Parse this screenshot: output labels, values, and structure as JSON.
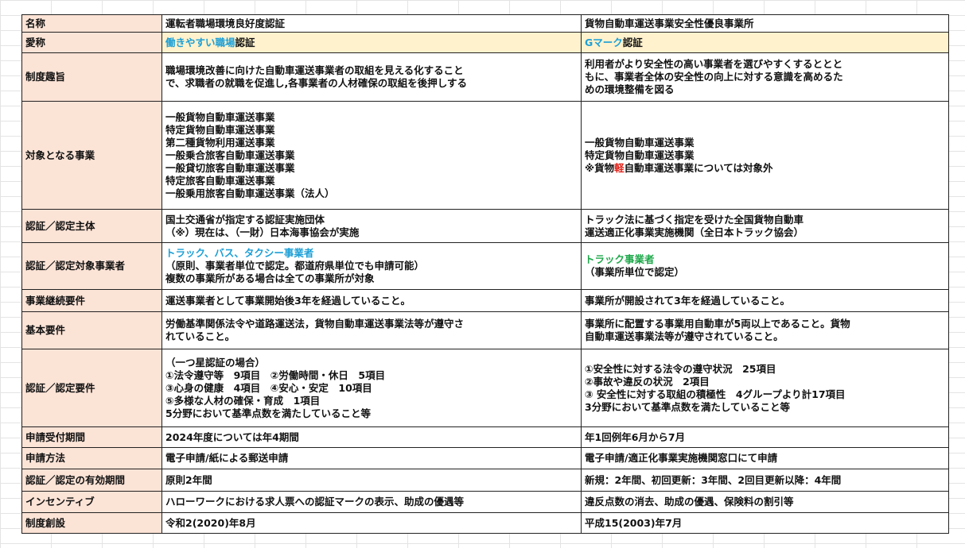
{
  "rows": {
    "name": {
      "label": "名称",
      "a": "運転者職場環境良好度認証",
      "b": "貨物自動車運送事業安全性優良事業所"
    },
    "nickname": {
      "label": "愛称",
      "a_highlight": "働きやすい職場",
      "a_suffix": "認証",
      "b_highlight": "Gマーク",
      "b_suffix": "認証"
    },
    "purpose": {
      "label": "制度趣旨",
      "a": [
        "職場環境改善に向けた自動車運送事業者の取組を見える化すること",
        "で、求職者の就職を促進し,各事業者の人材確保の取組を後押しする"
      ],
      "b": [
        "利用者がより安全性の高い事業者を選びやすくするととと",
        "もに、事業者全体の安全性の向上に対する意識を高めるた",
        "めの環境整備を図る"
      ]
    },
    "target_business": {
      "label": "対象となる事業",
      "a": [
        "一般貨物自動車運送事業",
        "特定貨物自動車運送事業",
        "第二種貨物利用運送事業",
        "一般乗合旅客自動車運送事業",
        "一般貸切旅客自動車運送事業",
        "特定旅客自動車運送事業",
        "一般乗用旅客自動車運送事業（法人）"
      ],
      "b": [
        "一般貨物自動車運送事業",
        "特定貨物自動車運送事業"
      ],
      "b_note_prefix": "※貨物",
      "b_note_red": "軽",
      "b_note_suffix": "自動車運送事業については対象外"
    },
    "certifier": {
      "label": "認証／認定主体",
      "a": [
        "国土交通省が指定する認証実施団体",
        "（※）現在は、（一財）日本海事協会が実施"
      ],
      "b": [
        "トラック法に基づく指定を受けた全国貨物自動車",
        "運送適正化事業実施機関（全日本トラック協会）"
      ]
    },
    "target_operator": {
      "label": "認証／認定対象事業者",
      "a_highlight": "トラック、バス、タクシー事業者",
      "a": [
        "（原則、事業者単位で認定。都道府県単位でも申請可能）",
        "複数の事業所がある場合は全ての事業所が対象"
      ],
      "b_highlight": "トラック事業者",
      "b": [
        "（事業所単位で認定）"
      ]
    },
    "continuity": {
      "label": "事業継続要件",
      "a": "運送事業者として事業開始後3年を経過していること。",
      "b": "事業所が開設されて3年を経過していること。"
    },
    "basic": {
      "label": "基本要件",
      "a": [
        "労働基準関係法令や道路運送法，貨物自動車運送事業法等が遵守さ",
        "れていること。"
      ],
      "b": [
        "事業所に配置する事業用自動車が5両以上であること。貨物",
        "自動車運送事業法等が遵守されていること。"
      ]
    },
    "requirements": {
      "label": "認証／認定要件",
      "a": [
        "（一つ星認証の場合）",
        "①法令遵守等　9項目　②労働時間・休日　5項目",
        "③心身の健康　4項目　④安心・安定　10項目",
        "⑤多様な人材の確保・育成　1項目",
        "5分野において基準点数を満たしていること等"
      ],
      "b": [
        "①安全性に対する法令の遵守状況　25項目",
        "②事故や違反の状況　2項目",
        "③ 安全性に対する取組の積極性　4グループより計17項目",
        "3分野において基準点数を満たしていること等"
      ]
    },
    "period": {
      "label": "申請受付期間",
      "a": "2024年度については年4期間",
      "b": "年1回例年6月から7月"
    },
    "method": {
      "label": "申請方法",
      "a": "電子申請/紙による郵送申請",
      "b": "電子申請/適正化事業実施機関窓口にて申請"
    },
    "validity": {
      "label": "認証／認定の有効期間",
      "a": "原則2年間",
      "b": "新規：2年間、初回更新：3年間、2回目更新以降：4年間"
    },
    "incentive": {
      "label": "インセンティブ",
      "a": "ハローワークにおける求人票への認証マークの表示、助成の優遇等",
      "b": "違反点数の消去、助成の優遇、保険料の割引等"
    },
    "founded": {
      "label": "制度創設",
      "a": "令和2(2020)年8月",
      "b": "平成15(2003)年7月"
    }
  }
}
